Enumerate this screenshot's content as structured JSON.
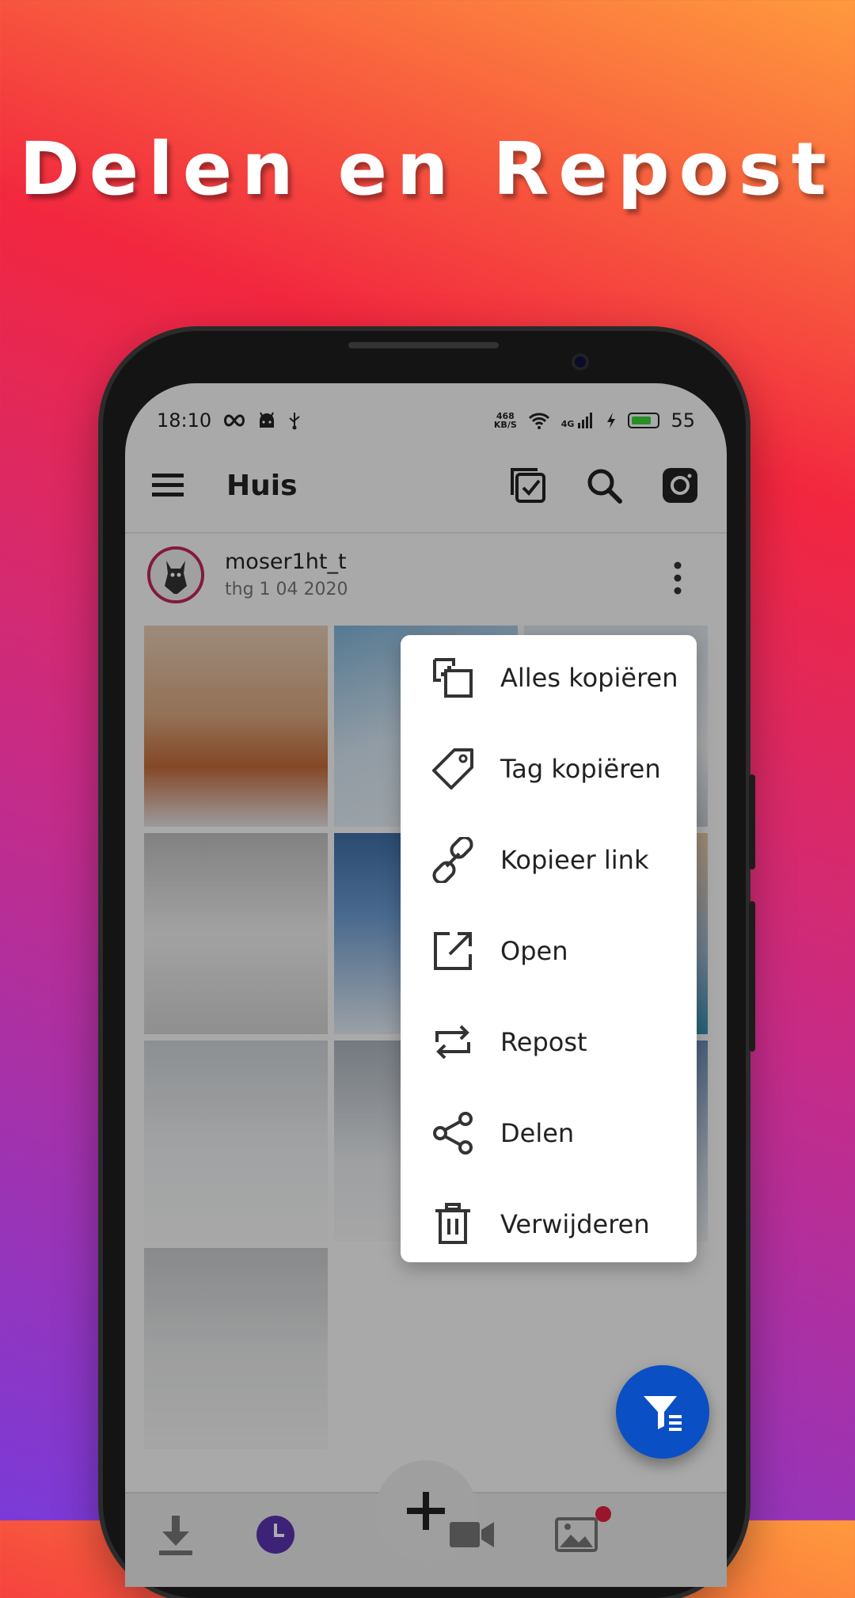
{
  "promo": {
    "title": "Delen en Repost"
  },
  "statusbar": {
    "time": "18:10",
    "net_speed_top": "468",
    "net_speed_bottom": "KB/S",
    "signal_type": "4G",
    "battery": "55"
  },
  "toolbar": {
    "title": "Huis"
  },
  "post": {
    "username": "moser1ht_t",
    "date": "thg 1 04 2020"
  },
  "menu": {
    "items": [
      {
        "label": "Alles kopiëren",
        "icon": "copy-all-icon"
      },
      {
        "label": "Tag kopiëren",
        "icon": "tag-icon"
      },
      {
        "label": "Kopieer link",
        "icon": "link-icon"
      },
      {
        "label": "Open",
        "icon": "open-external-icon"
      },
      {
        "label": "Repost",
        "icon": "repost-icon"
      },
      {
        "label": "Delen",
        "icon": "share-icon"
      },
      {
        "label": "Verwijderen",
        "icon": "trash-icon"
      }
    ]
  },
  "colors": {
    "fab": "#0a4fc4",
    "accent": "#5b34b0",
    "badge": "#e02040"
  }
}
